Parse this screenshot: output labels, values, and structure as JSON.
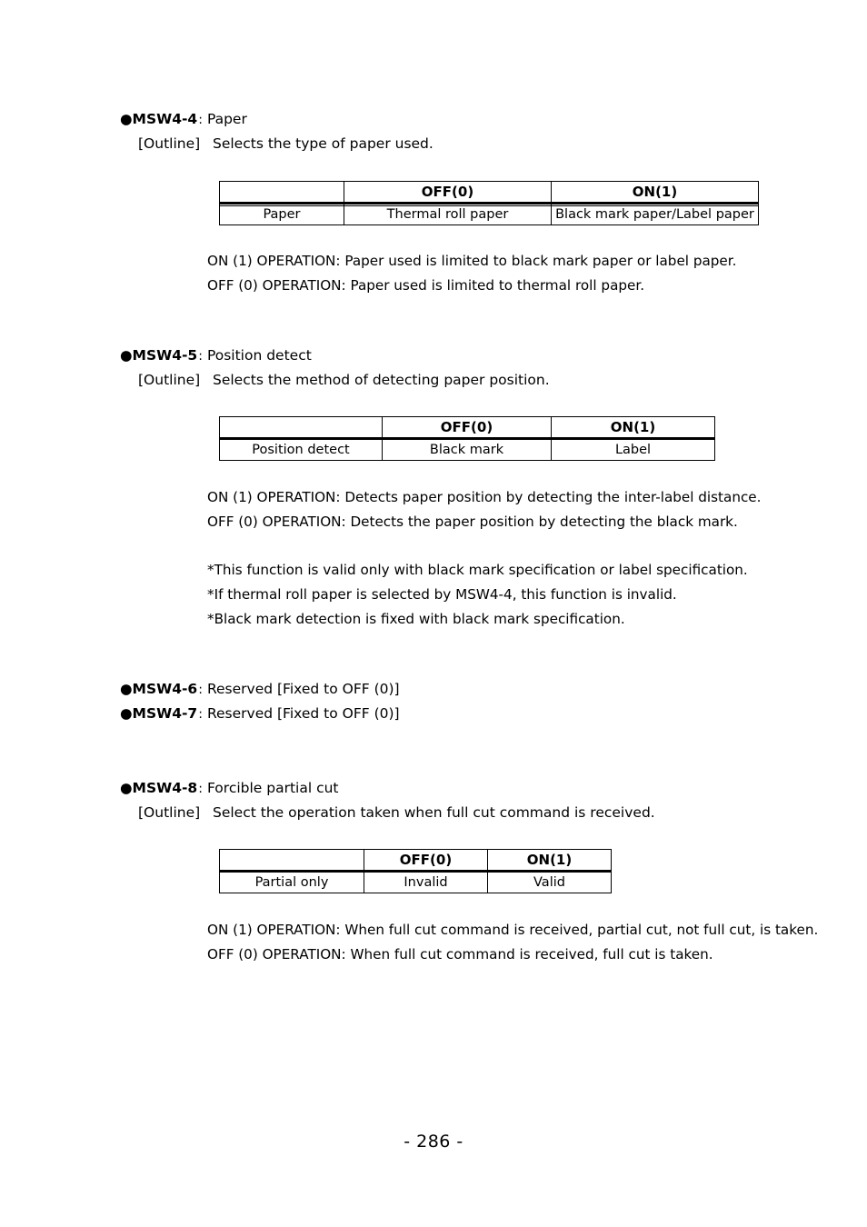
{
  "document": {
    "page_number": "- 286 -"
  },
  "sections": [
    {
      "id": "msw4-4",
      "bullet": "●",
      "key": "MSW4-4",
      "colon": ":",
      "title": "Paper",
      "outline_label": "[Outline]",
      "outline_text": "Selects the type of paper used.",
      "table": {
        "headers": [
          "",
          "OFF(0)",
          "ON(1)"
        ],
        "row": [
          "Paper",
          "Thermal roll paper",
          "Black mark paper/Label paper"
        ]
      },
      "notes": [
        "ON (1) OPERATION: Paper used is limited to black mark paper or label paper.",
        "OFF (0) OPERATION: Paper used is limited to thermal roll paper."
      ]
    },
    {
      "id": "msw4-5",
      "bullet": "●",
      "key": "MSW4-5",
      "colon": ":",
      "title": "Position detect",
      "outline_label": "[Outline]",
      "outline_text": "Selects the method of detecting paper position.",
      "table": {
        "headers": [
          "",
          "OFF(0)",
          "ON(1)"
        ],
        "row": [
          "Position detect",
          "Black mark",
          "Label"
        ]
      },
      "notes": [
        "ON (1) OPERATION: Detects paper position by detecting the inter-label distance.",
        "OFF (0) OPERATION: Detects the paper position by detecting the black mark."
      ],
      "footnotes": [
        "*This function is valid only with black mark specification or label specification.",
        "*If thermal roll paper is selected by MSW4-4, this function is invalid.",
        "*Black mark detection is fixed with black mark specification."
      ]
    },
    {
      "id": "msw4-6",
      "bullet": "●",
      "key": "MSW4-6",
      "colon": ":",
      "title": "Reserved [Fixed to OFF (0)]"
    },
    {
      "id": "msw4-7",
      "bullet": "●",
      "key": "MSW4-7",
      "colon": ":",
      "title": "Reserved [Fixed to OFF (0)]"
    },
    {
      "id": "msw4-8",
      "bullet": "●",
      "key": "MSW4-8",
      "colon": ":",
      "title": "Forcible partial cut",
      "outline_label": "[Outline]",
      "outline_text": "Select the operation taken when full cut command is received.",
      "table": {
        "headers": [
          "",
          "OFF(0)",
          "ON(1)"
        ],
        "row": [
          "Partial only",
          "Invalid",
          "Valid"
        ]
      },
      "notes": [
        "ON (1) OPERATION: When full cut command is received, partial cut, not full cut, is taken.",
        "OFF (0) OPERATION: When full cut command is received, full cut is taken."
      ]
    }
  ]
}
